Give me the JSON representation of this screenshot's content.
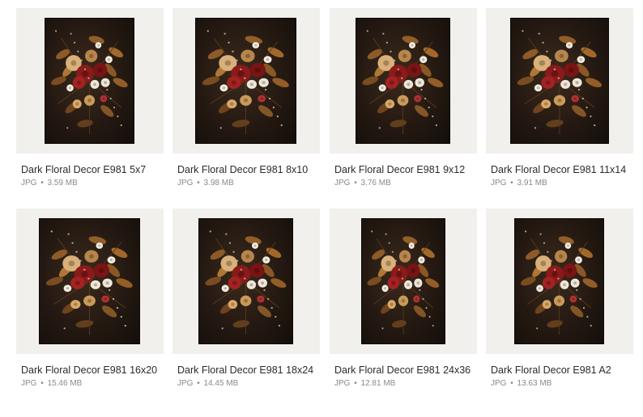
{
  "files": [
    {
      "name": "Dark Floral Decor E981 5x7",
      "type": "JPG",
      "size": "3.59 MB"
    },
    {
      "name": "Dark Floral Decor E981 8x10",
      "type": "JPG",
      "size": "3.98 MB"
    },
    {
      "name": "Dark Floral Decor E981 9x12",
      "type": "JPG",
      "size": "3.76 MB"
    },
    {
      "name": "Dark Floral Decor E981 11x14",
      "type": "JPG",
      "size": "3.91 MB"
    },
    {
      "name": "Dark Floral Decor E981 16x20",
      "type": "JPG",
      "size": "15.46 MB"
    },
    {
      "name": "Dark Floral Decor E981 18x24",
      "type": "JPG",
      "size": "14.45 MB"
    },
    {
      "name": "Dark Floral Decor E981 24x36",
      "type": "JPG",
      "size": "12.81 MB"
    },
    {
      "name": "Dark Floral Decor E981 A2",
      "type": "JPG",
      "size": "13.63 MB"
    }
  ],
  "separator": "•"
}
